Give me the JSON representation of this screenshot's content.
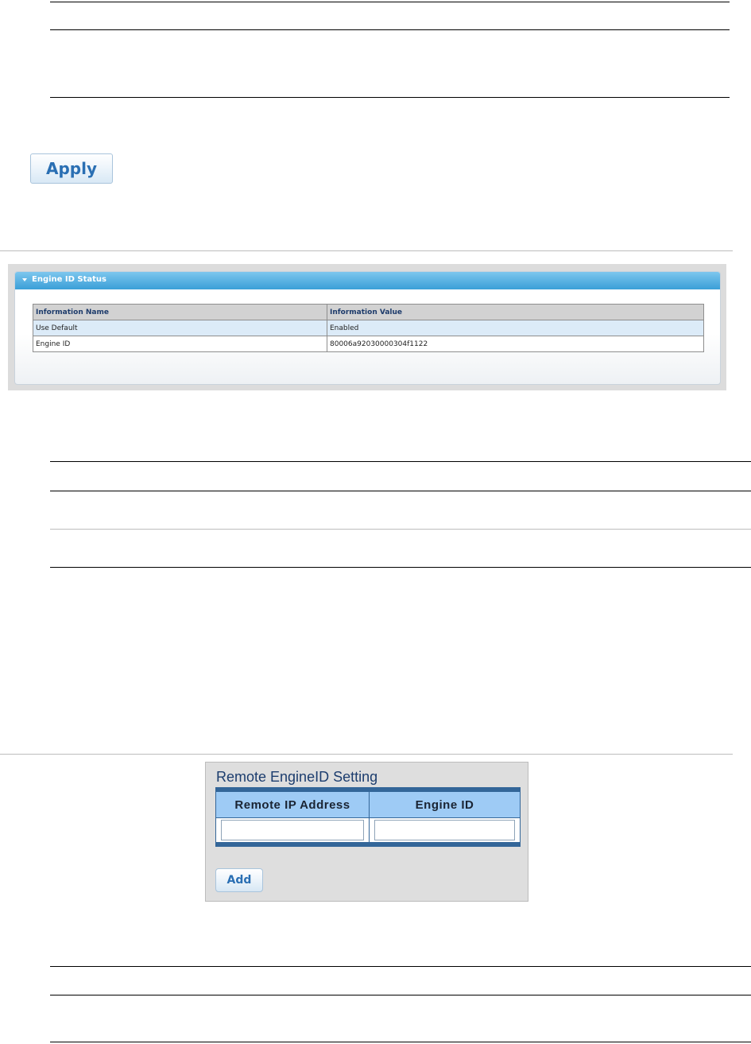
{
  "apply_button": {
    "label": "Apply"
  },
  "engine_id_status": {
    "title": "Engine ID Status",
    "columns": [
      "Information Name",
      "Information Value"
    ],
    "rows": [
      [
        "Use Default",
        "Enabled"
      ],
      [
        "Engine ID",
        "80006a92030000304f1122"
      ]
    ]
  },
  "remote_engineid_setting": {
    "title": "Remote EngineID Setting",
    "columns": [
      "Remote IP Address",
      "Engine ID"
    ],
    "inputs": {
      "remote_ip_value": "",
      "engine_id_value": ""
    },
    "add_label": "Add"
  }
}
